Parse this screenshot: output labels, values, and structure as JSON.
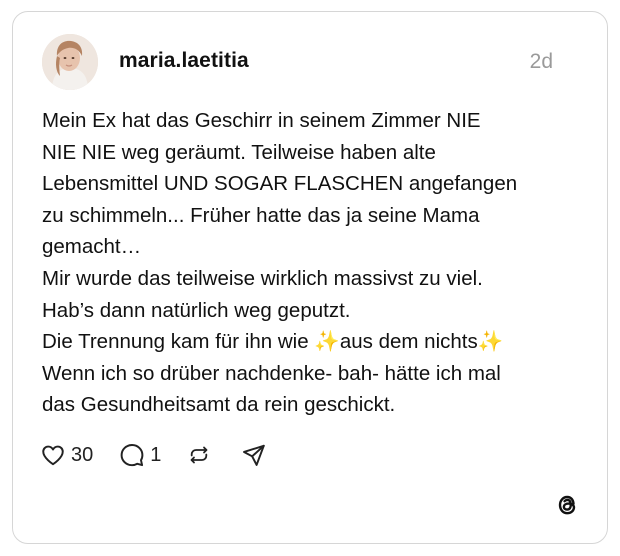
{
  "post": {
    "author": {
      "username": "maria.laetitia",
      "avatar": "profile-photo"
    },
    "timestamp": "2d",
    "lines": [
      "Mein Ex hat das Geschirr in seinem Zimmer NIE",
      "NIE NIE weg geräumt. Teilweise haben alte",
      "Lebensmittel UND SOGAR FLASCHEN angefangen",
      "zu schimmeln... Früher hatte das ja seine Mama",
      "gemacht…",
      "Mir wurde das teilweise wirklich massivst zu viel.",
      "Hab’s dann natürlich weg geputzt.",
      "Die Trennung kam  für ihn wie ✨aus dem nichts✨",
      "Wenn ich so drüber nachdenke- bah- hätte ich mal",
      "das Gesundheitsamt da rein geschickt."
    ],
    "actions": {
      "likes": "30",
      "replies": "1",
      "repost_icon": "repost-icon",
      "share_icon": "send-icon"
    }
  },
  "brand": {
    "logo": "threads-logo",
    "accent": "#111111",
    "muted": "#9a9a9a",
    "border": "#d6d6d6"
  }
}
